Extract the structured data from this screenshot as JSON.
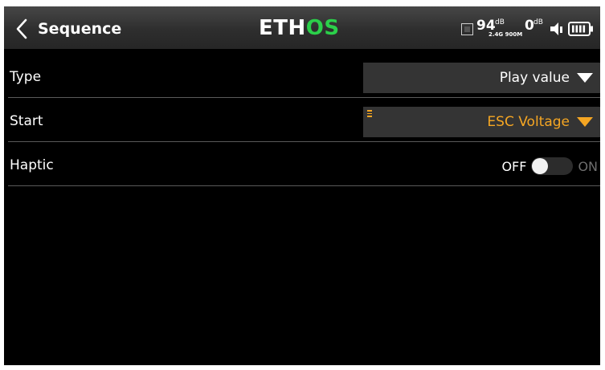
{
  "header": {
    "title": "Sequence",
    "logo_main": "ETH",
    "logo_accent": "OS",
    "rssi_value": "94",
    "rssi_unit": "dB",
    "rssi_bands": "2.4G 900M",
    "volume_value": "0",
    "volume_unit": "dB",
    "icons": [
      "chevron-left-icon",
      "module-icon",
      "speaker-icon",
      "battery-icon"
    ]
  },
  "rows": [
    {
      "label": "Type",
      "value": "Play value",
      "value_color": "#ffffff"
    },
    {
      "label": "Start",
      "value": "ESC Voltage",
      "value_color": "#f5a623"
    },
    {
      "label": "Haptic",
      "off_label": "OFF",
      "on_label": "ON",
      "state": "off"
    }
  ],
  "colors": {
    "accent_green": "#2bd04a",
    "accent_orange": "#f5a623",
    "background": "#000000",
    "row_field": "#343434"
  }
}
